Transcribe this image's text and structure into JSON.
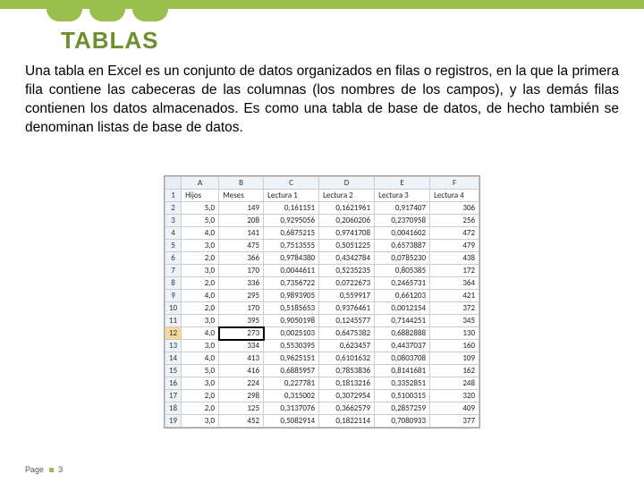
{
  "title": "TABLAS",
  "body": "Una tabla en Excel es un conjunto de datos organizados en filas o registros, en la que la primera fila contiene las cabeceras de las columnas (los nombres de los campos), y las demás filas contienen los datos almacenados. Es como una tabla de base de datos, de hecho también se denominan listas de base de datos.",
  "footer": {
    "label": "Page",
    "page": "3"
  },
  "excel": {
    "columns": [
      "A",
      "B",
      "C",
      "D",
      "E",
      "F"
    ],
    "header_row": [
      "Hijos",
      "Meses",
      "Lectura 1",
      "Lectura 2",
      "Lectura 3",
      "Lectura 4"
    ],
    "active_cell": {
      "row": 12,
      "col": 1
    },
    "highlight_row": 12,
    "rows": [
      {
        "n": 1,
        "cells": [
          "Hijos",
          "Meses",
          "Lectura 1",
          "Lectura 2",
          "Lectura 3",
          "Lectura 4"
        ],
        "header": true
      },
      {
        "n": 2,
        "cells": [
          "5,0",
          "149",
          "0,161151",
          "0,1621961",
          "0,917407",
          "306"
        ]
      },
      {
        "n": 3,
        "cells": [
          "5,0",
          "208",
          "0,9295056",
          "0,2060206",
          "0,2370958",
          "256"
        ]
      },
      {
        "n": 4,
        "cells": [
          "4,0",
          "141",
          "0,6875215",
          "0,9741708",
          "0,0041602",
          "472"
        ]
      },
      {
        "n": 5,
        "cells": [
          "3,0",
          "475",
          "0,7513555",
          "0,5051225",
          "0,6573887",
          "479"
        ]
      },
      {
        "n": 6,
        "cells": [
          "2,0",
          "366",
          "0,9784380",
          "0,4342784",
          "0,0785230",
          "438"
        ]
      },
      {
        "n": 7,
        "cells": [
          "3,0",
          "170",
          "0,0044611",
          "0,5235235",
          "0,805385",
          "172"
        ]
      },
      {
        "n": 8,
        "cells": [
          "2,0",
          "336",
          "0,7356722",
          "0,0722673",
          "0,2465731",
          "364"
        ]
      },
      {
        "n": 9,
        "cells": [
          "4,0",
          "295",
          "0,9893905",
          "0,559917",
          "0,661203",
          "421"
        ]
      },
      {
        "n": 10,
        "cells": [
          "2,0",
          "170",
          "0,5185653",
          "0,9376461",
          "0,0012154",
          "372"
        ]
      },
      {
        "n": 11,
        "cells": [
          "3,0",
          "395",
          "0,9050198",
          "0,1245577",
          "0,7144251",
          "345"
        ]
      },
      {
        "n": 12,
        "cells": [
          "4,0",
          "273",
          "0,0025103",
          "0,6475382",
          "0,6882888",
          "130"
        ]
      },
      {
        "n": 13,
        "cells": [
          "3,0",
          "334",
          "0,5530395",
          "0,623457",
          "0,4437037",
          "160"
        ]
      },
      {
        "n": 14,
        "cells": [
          "4,0",
          "413",
          "0,9625151",
          "0,6101632",
          "0,0803708",
          "109"
        ]
      },
      {
        "n": 15,
        "cells": [
          "5,0",
          "416",
          "0,6885957",
          "0,7853836",
          "0,8141681",
          "162"
        ]
      },
      {
        "n": 16,
        "cells": [
          "3,0",
          "224",
          "0,227781",
          "0,1813216",
          "0,3352851",
          "248"
        ]
      },
      {
        "n": 17,
        "cells": [
          "2,0",
          "298",
          "0,315002",
          "0,3072954",
          "0,5100315",
          "320"
        ]
      },
      {
        "n": 18,
        "cells": [
          "2,0",
          "125",
          "0,3137076",
          "0,3662579",
          "0,2857259",
          "409"
        ]
      },
      {
        "n": 19,
        "cells": [
          "3,0",
          "452",
          "0,5082914",
          "0,1822114",
          "0,7080933",
          "377"
        ]
      }
    ]
  }
}
